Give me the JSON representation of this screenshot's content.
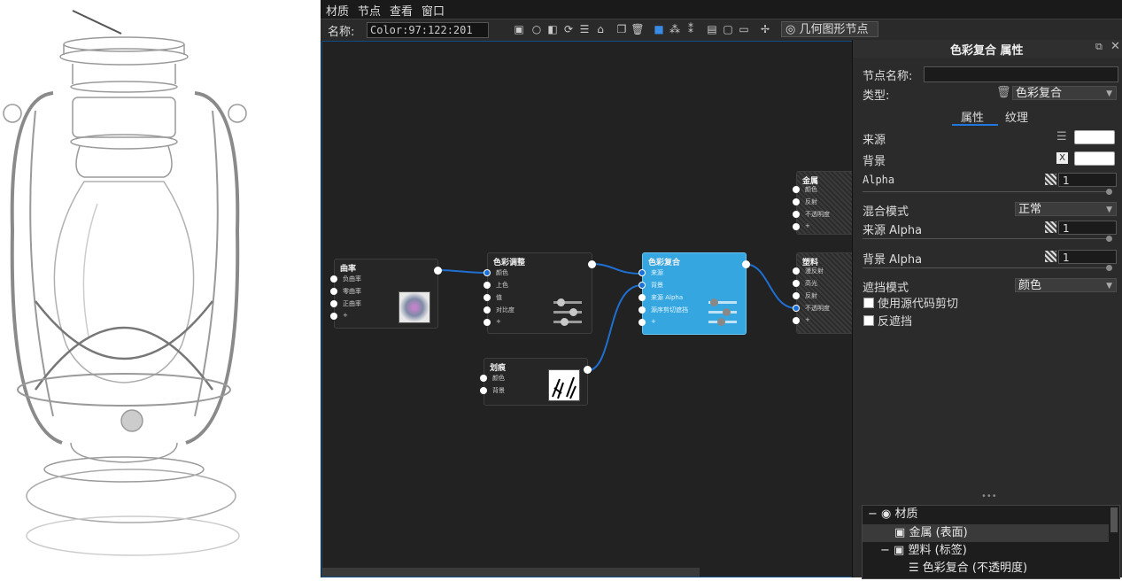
{
  "menu": [
    "材质",
    "节点",
    "查看",
    "窗口"
  ],
  "toolbar": {
    "name_label": "名称:",
    "name_value": "Color:97:122:201",
    "geometry_button": "几何图形节点"
  },
  "graph": {
    "nodes": {
      "curvature": {
        "title": "曲率",
        "inputs": [
          "负曲率",
          "零曲率",
          "正曲率",
          "+"
        ]
      },
      "color_adjust": {
        "title": "色彩调整",
        "inputs": [
          "颜色",
          "上色",
          "值",
          "对比度",
          "+"
        ]
      },
      "color_composite": {
        "title": "色彩复合",
        "inputs": [
          "来源",
          "背景",
          "来源 Alpha",
          "源序剪切遮挡",
          "+"
        ]
      },
      "scratch": {
        "title": "划痕",
        "inputs": [
          "颜色",
          "背景"
        ]
      },
      "metal": {
        "title": "金属",
        "inputs": [
          "颜色",
          "反射",
          "不透明度",
          "+"
        ]
      },
      "plastic": {
        "title": "塑料",
        "inputs": [
          "漫反射",
          "高光",
          "反射",
          "不透明度",
          "+"
        ]
      }
    }
  },
  "panel": {
    "title": "色彩复合 属性",
    "node_name_label": "节点名称:",
    "node_name_value": "",
    "type_label": "类型:",
    "type_value": "色彩复合",
    "tabs": [
      "属性",
      "纹理"
    ],
    "active_tab": "属性",
    "source_label": "来源",
    "background_label": "背景",
    "alpha_label": "Alpha",
    "alpha_value": "1",
    "blend_mode_label": "混合模式",
    "blend_mode_value": "正常",
    "source_alpha_label": "来源 Alpha",
    "source_alpha_value": "1",
    "background_alpha_label": "背景 Alpha",
    "background_alpha_value": "1",
    "mask_mode_label": "遮挡模式",
    "mask_mode_value": "颜色",
    "use_source_clip_label": "使用源代码剪切",
    "invert_mask_label": "反遮挡",
    "source_color": "#ffffff",
    "background_color": "#ffffff",
    "accent": "#35a6e0"
  },
  "tree": {
    "root_label": "材质",
    "items": [
      "金属 (表面)",
      "塑料 (标签)",
      "色彩复合 (不透明度)"
    ]
  }
}
